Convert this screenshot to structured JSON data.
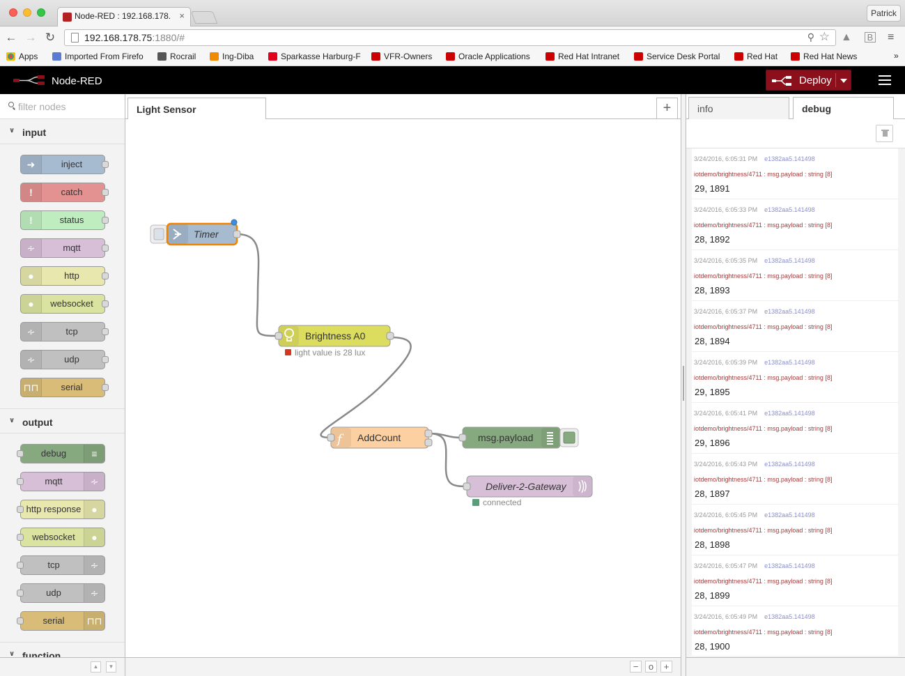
{
  "browser": {
    "tab_title": "Node-RED : 192.168.178.",
    "profile": "Patrick",
    "url_host": "192.168.178.75",
    "url_rest": ":1880/#",
    "bookmarks": [
      {
        "label": "Apps",
        "icon": "apps-grid-icon",
        "color": "#e44"
      },
      {
        "label": "Imported From Firefo",
        "icon": "folder-icon",
        "color": "#5a7bd4"
      },
      {
        "label": "Rocrail",
        "icon": "train-icon",
        "color": "#555"
      },
      {
        "label": "Ing-Diba",
        "icon": "lion-icon",
        "color": "#f08a00"
      },
      {
        "label": "Sparkasse Harburg-F",
        "icon": "sparkasse-icon",
        "color": "#e2001a"
      },
      {
        "label": "VFR-Owners",
        "icon": "vfr-icon",
        "color": "#c00"
      },
      {
        "label": "Oracle Applications",
        "icon": "redhat-icon",
        "color": "#c00"
      },
      {
        "label": "Red Hat Intranet",
        "icon": "redhat-icon",
        "color": "#c00"
      },
      {
        "label": "Service Desk Portal",
        "icon": "redhat-icon",
        "color": "#c00"
      },
      {
        "label": "Red Hat",
        "icon": "redhat-icon",
        "color": "#c00"
      },
      {
        "label": "Red Hat News",
        "icon": "redhat-icon",
        "color": "#c00"
      }
    ],
    "bookmarks_more": "»"
  },
  "app": {
    "title": "Node-RED",
    "deploy_label": "Deploy"
  },
  "palette": {
    "filter_placeholder": "filter nodes",
    "categories": [
      {
        "name": "input",
        "nodes": [
          {
            "label": "inject",
            "color": "#a6bbcf",
            "icon": "inject-arrow-icon"
          },
          {
            "label": "catch",
            "color": "#e49191",
            "icon": "exclamation-icon"
          },
          {
            "label": "status",
            "color": "#c0edc0",
            "icon": "exclamation-icon"
          },
          {
            "label": "mqtt",
            "color": "#d8bfd8",
            "icon": "bridge-waves-icon"
          },
          {
            "label": "http",
            "color": "#e7e7ae",
            "icon": "globe-icon"
          },
          {
            "label": "websocket",
            "color": "#dbe3a1",
            "icon": "globe-icon"
          },
          {
            "label": "tcp",
            "color": "#c0c0c0",
            "icon": "bridge-waves-icon"
          },
          {
            "label": "udp",
            "color": "#c0c0c0",
            "icon": "bridge-waves-icon"
          },
          {
            "label": "serial",
            "color": "#d8bc78",
            "icon": "serial-pulse-icon"
          }
        ]
      },
      {
        "name": "output",
        "nodes": [
          {
            "label": "debug",
            "color": "#87a980",
            "icon": "debug-list-icon"
          },
          {
            "label": "mqtt",
            "color": "#d8bfd8",
            "icon": "bridge-waves-icon"
          },
          {
            "label": "http response",
            "color": "#e7e7ae",
            "icon": "globe-icon"
          },
          {
            "label": "websocket",
            "color": "#dbe3a1",
            "icon": "globe-icon"
          },
          {
            "label": "tcp",
            "color": "#c0c0c0",
            "icon": "bridge-waves-icon"
          },
          {
            "label": "udp",
            "color": "#c0c0c0",
            "icon": "bridge-waves-icon"
          },
          {
            "label": "serial",
            "color": "#d8bc78",
            "icon": "serial-pulse-icon"
          }
        ]
      },
      {
        "name": "function",
        "nodes": []
      }
    ]
  },
  "workspace": {
    "tab_label": "Light Sensor",
    "add_tab": "+",
    "flow": {
      "timer": {
        "label": "Timer",
        "color": "#a6bbcf"
      },
      "brightness": {
        "label": "Brightness A0",
        "color": "#dcdc5e",
        "status": "light value is 28 lux",
        "status_color": "#d9361e"
      },
      "addcount": {
        "label": "AddCount",
        "color": "#fdd0a2"
      },
      "msgpayload": {
        "label": "msg.payload",
        "color": "#87a980"
      },
      "gateway": {
        "label": "Deliver-2-Gateway",
        "color": "#d8bfd8",
        "status": "connected",
        "status_color": "#5a9d7a"
      }
    },
    "zoom": {
      "out": "−",
      "reset": "o",
      "in": "+"
    }
  },
  "sidebar": {
    "tab_info": "info",
    "tab_debug": "debug",
    "messages": [
      {
        "time": "3/24/2016, 6:05:31 PM",
        "node": "e1382aa5.141498",
        "topic": "iotdemo/brightness/4711 : msg.payload : string [8]",
        "payload": "29, 1891"
      },
      {
        "time": "3/24/2016, 6:05:33 PM",
        "node": "e1382aa5.141498",
        "topic": "iotdemo/brightness/4711 : msg.payload : string [8]",
        "payload": "28, 1892"
      },
      {
        "time": "3/24/2016, 6:05:35 PM",
        "node": "e1382aa5.141498",
        "topic": "iotdemo/brightness/4711 : msg.payload : string [8]",
        "payload": "28, 1893"
      },
      {
        "time": "3/24/2016, 6:05:37 PM",
        "node": "e1382aa5.141498",
        "topic": "iotdemo/brightness/4711 : msg.payload : string [8]",
        "payload": "28, 1894"
      },
      {
        "time": "3/24/2016, 6:05:39 PM",
        "node": "e1382aa5.141498",
        "topic": "iotdemo/brightness/4711 : msg.payload : string [8]",
        "payload": "29, 1895"
      },
      {
        "time": "3/24/2016, 6:05:41 PM",
        "node": "e1382aa5.141498",
        "topic": "iotdemo/brightness/4711 : msg.payload : string [8]",
        "payload": "29, 1896"
      },
      {
        "time": "3/24/2016, 6:05:43 PM",
        "node": "e1382aa5.141498",
        "topic": "iotdemo/brightness/4711 : msg.payload : string [8]",
        "payload": "28, 1897"
      },
      {
        "time": "3/24/2016, 6:05:45 PM",
        "node": "e1382aa5.141498",
        "topic": "iotdemo/brightness/4711 : msg.payload : string [8]",
        "payload": "28, 1898"
      },
      {
        "time": "3/24/2016, 6:05:47 PM",
        "node": "e1382aa5.141498",
        "topic": "iotdemo/brightness/4711 : msg.payload : string [8]",
        "payload": "28, 1899"
      },
      {
        "time": "3/24/2016, 6:05:49 PM",
        "node": "e1382aa5.141498",
        "topic": "iotdemo/brightness/4711 : msg.payload : string [8]",
        "payload": "28, 1900"
      }
    ]
  }
}
